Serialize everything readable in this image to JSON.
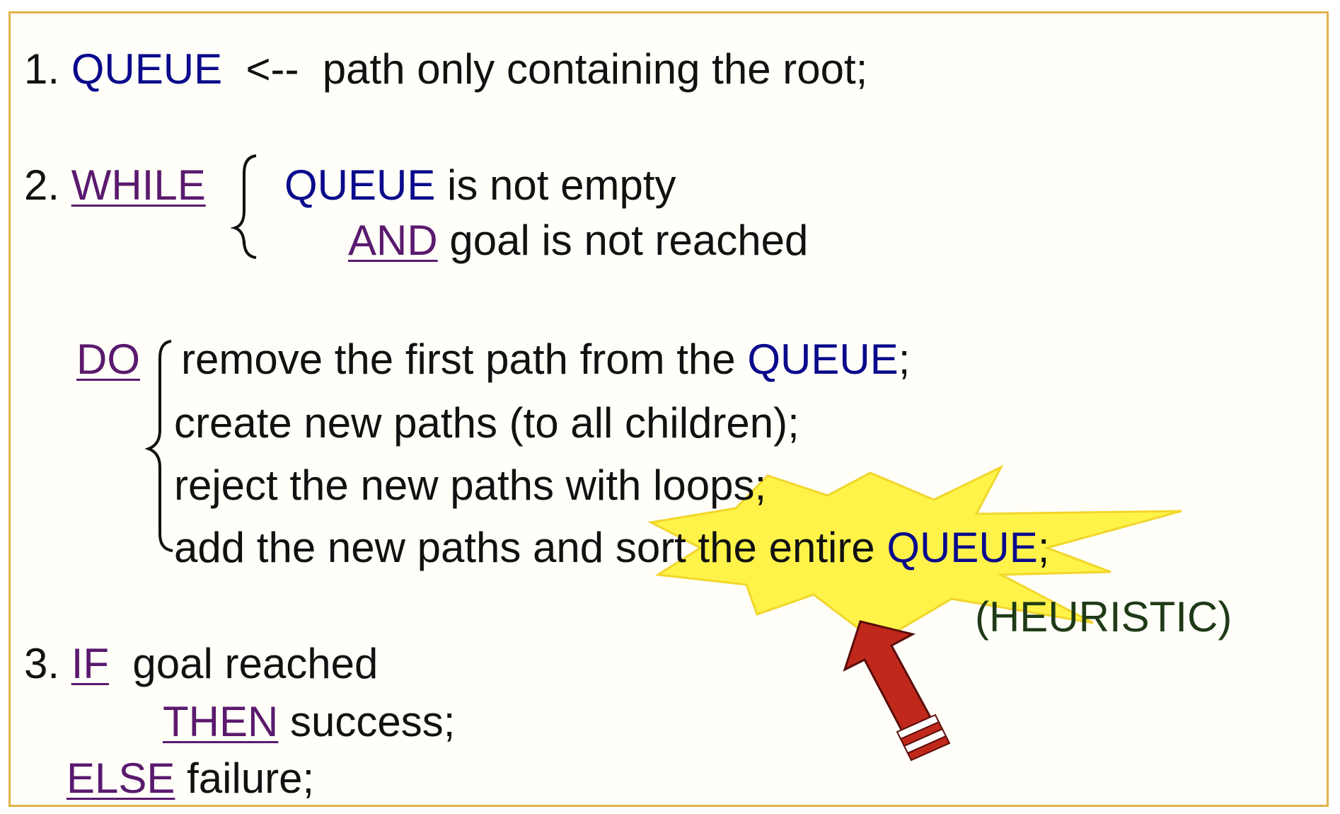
{
  "step1": {
    "num": "1.",
    "queue": "QUEUE",
    "arrow": "<--",
    "text": "path only containing the root;"
  },
  "step2": {
    "num": "2.",
    "while": "WHILE",
    "queue": "QUEUE",
    "cond1_rest": "is not empty",
    "and": "AND",
    "cond2_rest": "goal is not reached"
  },
  "do_block": {
    "do": "DO",
    "line1_text": "remove the first path from the",
    "line1_queue": "QUEUE",
    "line1_end": ";",
    "line2": "create new paths (to all children);",
    "line3": "reject the new paths with loops;",
    "line4_text": "add the new paths and sort the entire",
    "line4_queue": "QUEUE",
    "line4_end": ";"
  },
  "heuristic": "(HEURISTIC)",
  "step3": {
    "num": "3.",
    "if": "IF",
    "if_rest": "goal reached",
    "then": "THEN",
    "then_rest": "success;",
    "else": "ELSE",
    "else_rest": "failure;"
  },
  "colors": {
    "frame": "#e2b34a",
    "queue": "#0a0a8c",
    "keyword": "#5a1a6e",
    "text": "#111111",
    "heuristic": "#1f3a16",
    "starburst": "#fff34a",
    "arrow": "#c0281c"
  },
  "icons": {
    "burst": "starburst-shape",
    "arrow": "red-arrow-up-left"
  }
}
